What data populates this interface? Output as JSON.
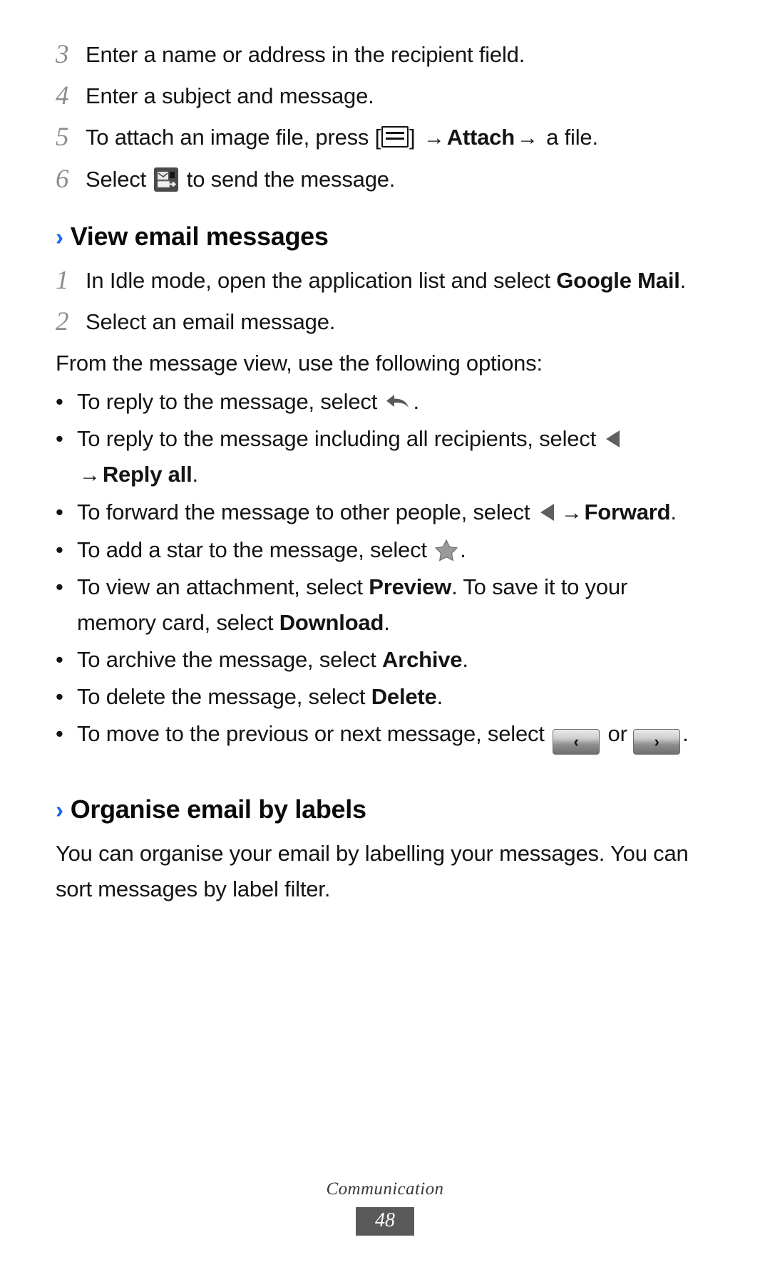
{
  "page": {
    "footer_chapter": "Communication",
    "footer_page_number": "48",
    "accent_color": "#1565f0",
    "page_box_color": "#595959"
  },
  "steps_top": [
    {
      "num": "3",
      "text": "Enter a name or address in the recipient field."
    },
    {
      "num": "4",
      "text": "Enter a subject and message."
    },
    {
      "num": "5",
      "text_before": "To attach an image file, press [",
      "icon": "menu-key-icon",
      "text_mid": "] ",
      "arrow1": "→",
      "bold1": "Attach",
      "arrow2": "→",
      "text_after": " a file."
    },
    {
      "num": "6",
      "text_before": "Select ",
      "icon": "send-icon",
      "text_after": " to send the message."
    }
  ],
  "section_view": {
    "chevron": "›",
    "title": "View email messages",
    "steps": [
      {
        "num": "1",
        "text_before": "In Idle mode, open the application list and select ",
        "bold": "Google Mail",
        "text_after": "."
      },
      {
        "num": "2",
        "text": "Select an email message."
      }
    ],
    "intro": "From the message view, use the following options:",
    "bullets": [
      {
        "dot": "•",
        "text_before": "To reply to the message, select ",
        "icon": "reply-arrow-icon",
        "text_after": "."
      },
      {
        "dot": "•",
        "text_before": "To reply to the message including all recipients, select ",
        "icon": "reply-all-triangle-icon",
        "arrow": "→",
        "bold": "Reply all",
        "text_after": "."
      },
      {
        "dot": "•",
        "text_before": "To forward the message to other people, select ",
        "icon": "forward-triangle-icon",
        "arrow": "→",
        "bold": "Forward",
        "text_after": "."
      },
      {
        "dot": "•",
        "text_before": "To add a star to the message, select ",
        "icon": "star-icon",
        "text_after": "."
      },
      {
        "dot": "•",
        "text_before": "To view an attachment, select ",
        "bold": "Preview",
        "text_mid": ". To save it to your memory card, select ",
        "bold2": "Download",
        "text_after": "."
      },
      {
        "dot": "•",
        "text_before": "To archive the message, select ",
        "bold": "Archive",
        "text_after": "."
      },
      {
        "dot": "•",
        "text_before": "To delete the message, select ",
        "bold": "Delete",
        "text_after": "."
      },
      {
        "dot": "•",
        "text_before": "To move to the previous or next message, select ",
        "icon": "previous-message-button",
        "prev_glyph": "‹",
        "text_mid": " or ",
        "icon2": "next-message-button",
        "next_glyph": "›",
        "text_after": "."
      }
    ]
  },
  "section_organise": {
    "chevron": "›",
    "title": "Organise email by labels",
    "paragraph": "You can organise your email by labelling your messages. You can sort messages by label filter."
  }
}
